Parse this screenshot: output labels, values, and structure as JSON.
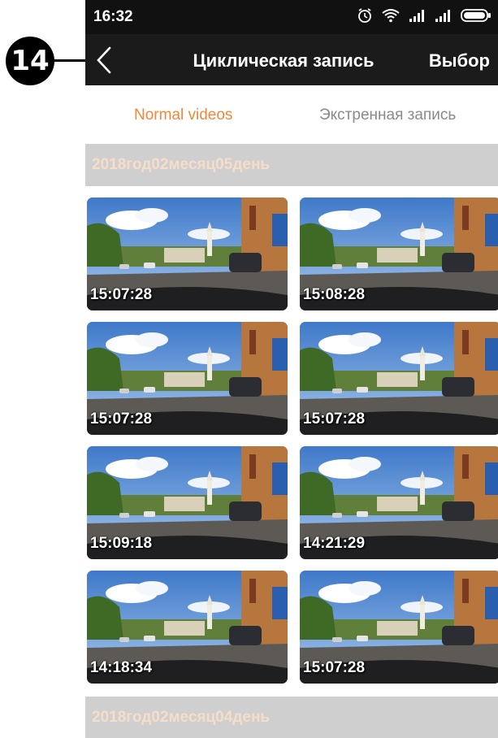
{
  "annotation": {
    "number": "14"
  },
  "status_bar": {
    "time": "16:32"
  },
  "header": {
    "title": "Циклическая запись",
    "action": "Выбор"
  },
  "tabs": {
    "normal": "Normal videos",
    "emergency": "Экстренная запись"
  },
  "sections": [
    {
      "date": "2018год02месяц05день",
      "videos": [
        {
          "time": "15:07:28"
        },
        {
          "time": "15:08:28"
        },
        {
          "time": "15:07:28"
        },
        {
          "time": "15:07:28"
        },
        {
          "time": "15:09:18"
        },
        {
          "time": "14:21:29"
        },
        {
          "time": "14:18:34"
        },
        {
          "time": "15:07:28"
        }
      ]
    },
    {
      "date": "2018год02месяц04день",
      "videos": []
    }
  ],
  "colors": {
    "accent": "#f0873a",
    "inactive_tab": "#8a8a8a",
    "navbar": "#1b1b1b",
    "status_bar": "#111111",
    "date_header_bg": "#cfcfcf",
    "date_header_text": "#f6ddc9"
  }
}
